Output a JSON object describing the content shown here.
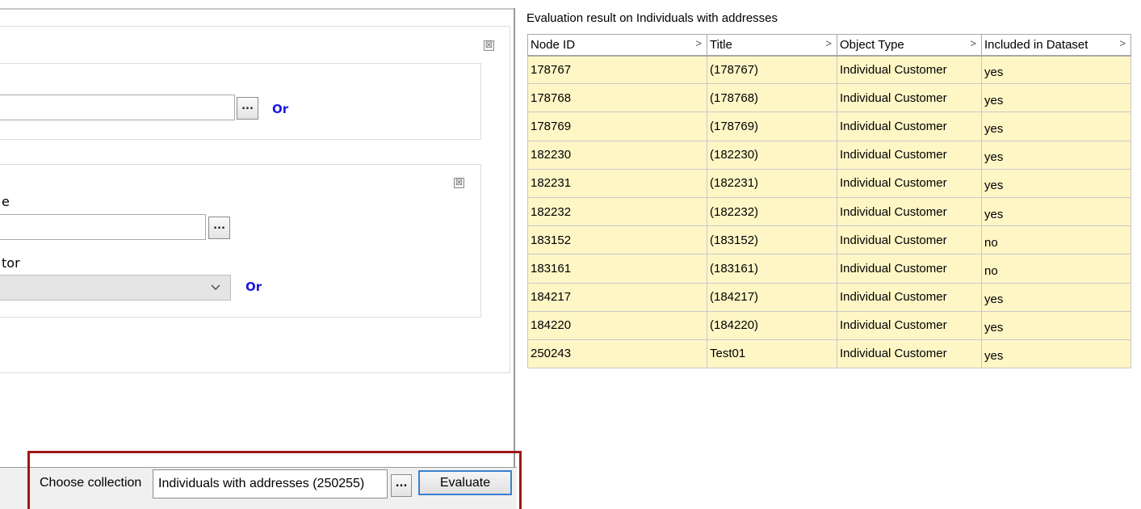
{
  "left_panel": {
    "group1": {
      "or_label": "Or",
      "browse_label": "..."
    },
    "group2": {
      "label_fragment_1": "e",
      "label_fragment_2": "tor",
      "browse_label": "...",
      "or_label": "Or",
      "select_value": ""
    },
    "remove_icon_glyph": "☒"
  },
  "bottom_bar": {
    "choose_label": "Choose collection",
    "collection_value": "Individuals with addresses (250255)",
    "browse_label": "...",
    "evaluate_label": "Evaluate"
  },
  "results": {
    "title": "Evaluation result on Individuals with addresses",
    "columns": [
      "Node ID",
      "Title",
      "Object Type",
      "Included in Dataset"
    ],
    "sort_glyph": ">",
    "rows": [
      [
        "178767",
        "(178767)",
        "Individual Customer",
        "yes"
      ],
      [
        "178768",
        "(178768)",
        "Individual Customer",
        "yes"
      ],
      [
        "178769",
        "(178769)",
        "Individual Customer",
        "yes"
      ],
      [
        "182230",
        "(182230)",
        "Individual Customer",
        "yes"
      ],
      [
        "182231",
        "(182231)",
        "Individual Customer",
        "yes"
      ],
      [
        "182232",
        "(182232)",
        "Individual Customer",
        "yes"
      ],
      [
        "183152",
        "(183152)",
        "Individual Customer",
        "no"
      ],
      [
        "183161",
        "(183161)",
        "Individual Customer",
        "no"
      ],
      [
        "184217",
        "(184217)",
        "Individual Customer",
        "yes"
      ],
      [
        "184220",
        "(184220)",
        "Individual Customer",
        "yes"
      ],
      [
        "250243",
        "Test01",
        "Individual Customer",
        "yes"
      ]
    ]
  },
  "colors": {
    "row_background": "#fff6c6",
    "highlight_border": "#a01515",
    "or_link": "#1a1ae0",
    "focus_border": "#3c7fd0"
  }
}
